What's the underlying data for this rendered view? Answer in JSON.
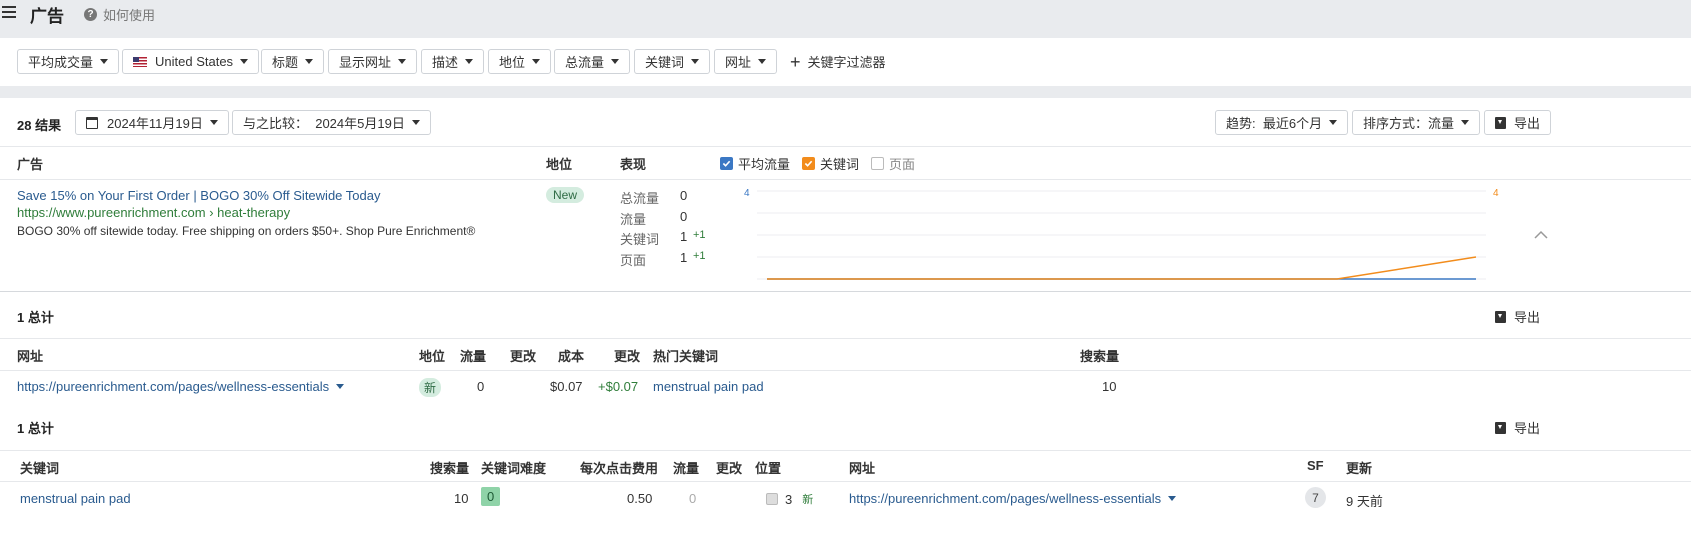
{
  "header": {
    "title": "广告",
    "help_label": "如何使用"
  },
  "filters": {
    "avg_volume": "平均成交量",
    "country": "United States",
    "title": "标题",
    "display_url": "显示网址",
    "description": "描述",
    "position": "地位",
    "traffic": "总流量",
    "keywords": "关键词",
    "url": "网址",
    "keyword_filter": "关键字过滤器"
  },
  "results": {
    "count_label": "28 结果",
    "date": "2024年11月19日",
    "compare": "与之比较：  2024年5月19日",
    "trend": "趋势:  最近6个月",
    "sort": "排序方式：流量",
    "export": "导出"
  },
  "ads_table": {
    "columns": {
      "ad": "广告",
      "position": "地位",
      "performance": "表现"
    },
    "legend": {
      "avg_traffic": "平均流量",
      "keywords": "关键词",
      "pages": "页面"
    },
    "row": {
      "title": "Save 15% on Your First Order | BOGO 30% Off Sitewide Today",
      "url": "https://www.pureenrichment.com › heat-therapy",
      "description": "BOGO 30% off sitewide today. Free shipping on orders $50+. Shop Pure Enrichment®",
      "badge": "New",
      "metrics": [
        {
          "label": "总流量",
          "value": "0",
          "delta": ""
        },
        {
          "label": "流量",
          "value": "0",
          "delta": ""
        },
        {
          "label": "关键词",
          "value": "1",
          "delta": "+1"
        },
        {
          "label": "页面",
          "value": "1",
          "delta": "+1"
        }
      ],
      "chart": {
        "y_left": "4",
        "y_right": "4",
        "colors": {
          "traffic": "#3b78c4",
          "keywords": "#f28c1c"
        }
      }
    }
  },
  "urls_table": {
    "total": "1 总计",
    "export": "导出",
    "columns": {
      "url": "网址",
      "position": "地位",
      "traffic": "流量",
      "change": "更改",
      "cost": "成本",
      "change2": "更改",
      "top_keyword": "热门关键词",
      "volume": "搜索量"
    },
    "row": {
      "url": "https://pureenrichment.com/pages/wellness-essentials",
      "badge": "新",
      "traffic": "0",
      "change": "",
      "cost": "$0.07",
      "change2": "+$0.07",
      "top_keyword": "menstrual pain pad",
      "volume": "10"
    }
  },
  "keywords_table": {
    "total": "1 总计",
    "export": "导出",
    "columns": {
      "keyword": "关键词",
      "volume": "搜索量",
      "kd": "关键词难度",
      "cpc": "每次点击费用",
      "traffic": "流量",
      "change": "更改",
      "position": "位置",
      "url": "网址",
      "sf": "SF",
      "updated": "更新"
    },
    "row": {
      "keyword": "menstrual pain pad",
      "volume": "10",
      "kd": "0",
      "cpc": "0.50",
      "traffic": "0",
      "position": "3",
      "position_tag": "新",
      "url": "https://pureenrichment.com/pages/wellness-essentials",
      "sf": "7",
      "updated": "9 天前"
    }
  }
}
